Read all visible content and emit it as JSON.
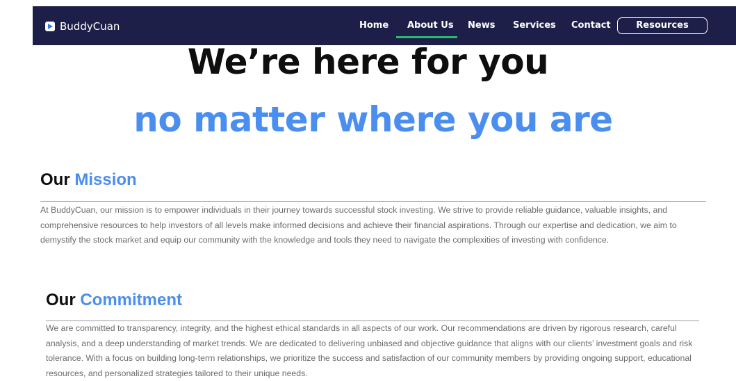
{
  "nav": {
    "brand": "BuddyCuan",
    "links": [
      {
        "label": "Home"
      },
      {
        "label": "About Us"
      },
      {
        "label": "News"
      },
      {
        "label": "Services"
      },
      {
        "label": "Contact"
      }
    ],
    "active": "About Us",
    "resources_label": "Resources"
  },
  "hero": {
    "title": "We’re here for you",
    "subtitle": "no matter where you are"
  },
  "mission": {
    "heading_dark": "Our",
    "heading_accent": "Mission",
    "body": "At BuddyCuan, our mission is to empower individuals in their journey towards successful stock investing. We strive to provide reliable guidance, valuable insights, and comprehensive resources to help investors of all levels make informed decisions and achieve their financial aspirations. Through our expertise and dedication, we aim to demystify the stock market and equip our community with the knowledge and tools they need to navigate the complexities of investing with confidence."
  },
  "commitment": {
    "heading_dark": "Our",
    "heading_accent": "Commitment",
    "body": "We are committed to transparency, integrity, and the highest ethical standards in all aspects of our work. Our recommendations are driven by rigorous research, careful analysis, and a deep understanding of market trends. We are dedicated to delivering unbiased and objective guidance that aligns with our clients’ investment goals and risk tolerance. With a focus on building long-term relationships, we prioritize the success and satisfaction of our community members by providing ongoing support, educational resources, and personalized strategies tailored to their unique needs."
  },
  "colors": {
    "nav_background": "#1e1f48",
    "accent_blue": "#4a8ef0",
    "active_underline": "#2bb673"
  }
}
